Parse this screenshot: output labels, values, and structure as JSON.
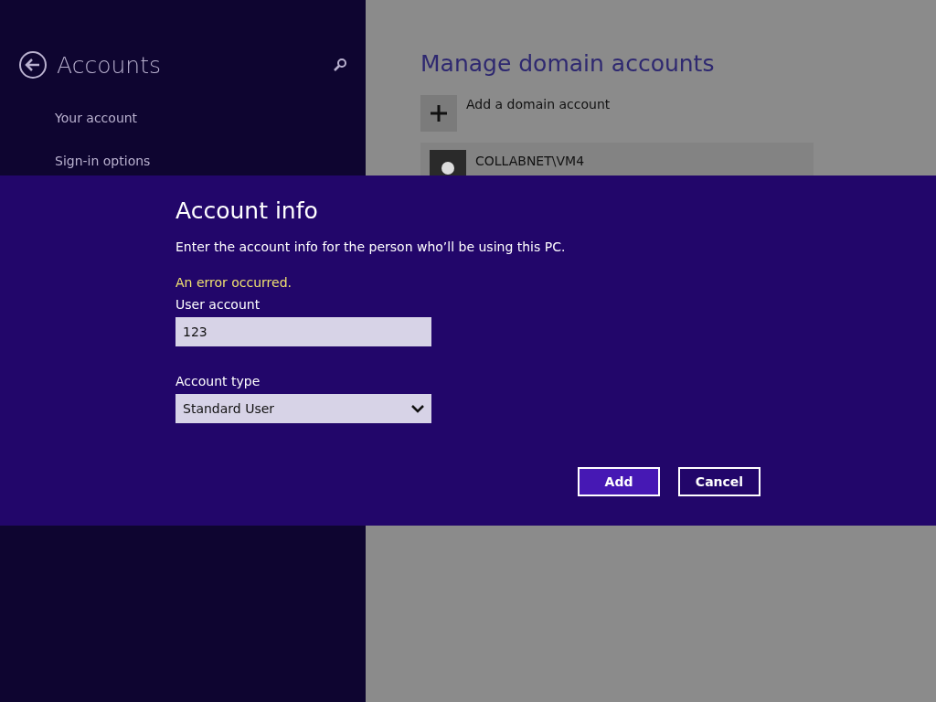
{
  "settings_pane": {
    "title": "Accounts",
    "nav_items": [
      {
        "label": "Your account"
      },
      {
        "label": "Sign-in options"
      }
    ]
  },
  "main": {
    "title": "Manage domain accounts",
    "add_label": "Add a domain account",
    "accounts": [
      {
        "name": "COLLABNET\\VM4"
      }
    ]
  },
  "dialog": {
    "title": "Account info",
    "description": "Enter the account info for the person who’ll be using this PC.",
    "error": "An error occurred.",
    "user_account": {
      "label": "User account",
      "value": "123"
    },
    "account_type": {
      "label": "Account type",
      "value": "Standard User"
    },
    "buttons": [
      {
        "label": "Add",
        "kind": "primary"
      },
      {
        "label": "Cancel",
        "kind": "secondary"
      }
    ]
  }
}
